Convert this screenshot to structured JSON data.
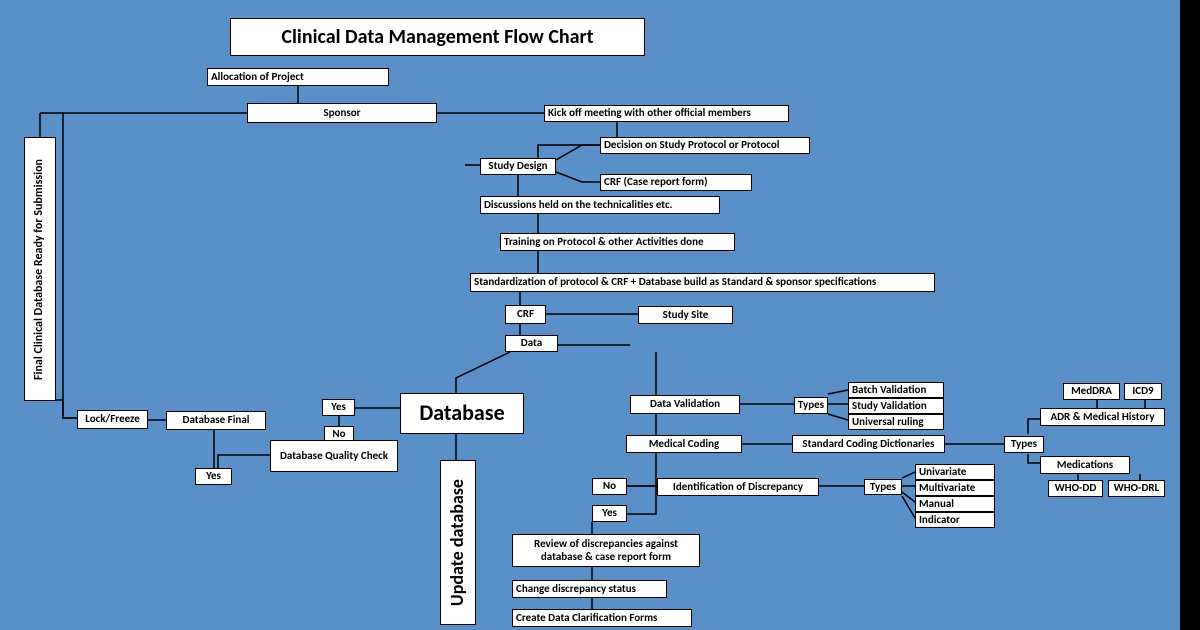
{
  "title": "Clinical Data Management Flow Chart",
  "boxes": {
    "allocation": "Allocation of Project",
    "sponsor": "Sponsor",
    "kickoff": "Kick off meeting with other official members",
    "study_design": "Study Design",
    "decision_protocol": "Decision on Study Protocol or Protocol",
    "crf_form": "CRF (Case report form)",
    "discussions": "Discussions held on the technicalities etc.",
    "training": "Training on Protocol & other Activities done",
    "standardization": "Standardization of protocol & CRF + Database build as Standard & sponsor specifications",
    "crf": "CRF",
    "study_site": "Study Site",
    "data": "Data",
    "database": "Database",
    "data_validation": "Data Validation",
    "types1": "Types",
    "batch_validation": "Batch Validation",
    "study_validation": "Study Validation",
    "universal_ruling": "Universal ruling",
    "medical_coding": "Medical Coding",
    "standard_coding": "Standard Coding Dictionaries",
    "types2": "Types",
    "meddra": "MedDRA",
    "icd9": "ICD9",
    "adr_history": "ADR & Medical History",
    "medications": "Medications",
    "who_dd": "WHO-DD",
    "who_drl": "WHO-DRL",
    "no": "No",
    "yes": "Yes",
    "identification_discrepancy": "Identification of Discrepancy",
    "types3": "Types",
    "univariate": "Univariate",
    "multivariate": "Multivariate",
    "manual": "Manual",
    "indicator": "Indicator",
    "review_discrepancies": "Review of discrepancies against database & case report form",
    "change_discrepancy": "Change discrepancy status",
    "create_dcf": "Create Data Clarification Forms",
    "update_database": "Update database",
    "database_quality_check": "Database Quality Check",
    "no2": "No",
    "yes2": "Yes",
    "yes3": "Yes",
    "database_final": "Database Final",
    "lock_freeze": "Lock/Freeze",
    "final_clinical": "Final Clinical Database Ready for Submission"
  }
}
